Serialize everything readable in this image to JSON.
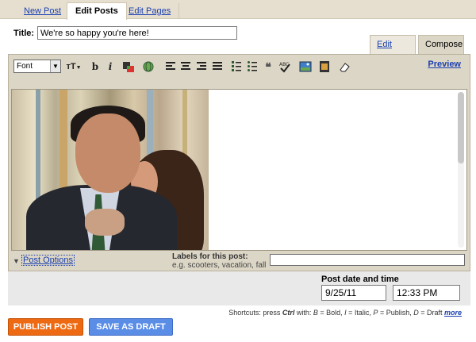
{
  "tabs": {
    "new_post": "New Post",
    "edit_posts": "Edit Posts",
    "edit_pages": "Edit Pages"
  },
  "title": {
    "label": "Title:",
    "value": "We're so happy you're here!"
  },
  "modes": {
    "edit_html": "Edit Html",
    "compose": "Compose"
  },
  "toolbar": {
    "font_select": "Font",
    "text_size": "тT",
    "bold": "b",
    "italic": "i",
    "preview": "Preview"
  },
  "post_options": {
    "link": "Post Options",
    "labels_title": "Labels for this post:",
    "labels_hint": "e.g. scooters, vacation, fall",
    "labels_value": ""
  },
  "post_date": {
    "label": "Post date and time",
    "date": "9/25/11",
    "time": "12:33 PM"
  },
  "shortcuts": {
    "prefix": "Shortcuts: press ",
    "ctrl": "Ctrl",
    "with": " with: ",
    "b": "B",
    "bold": " = Bold, ",
    "i": "I",
    "italic": " = Italic, ",
    "p": "P",
    "publish": " = Publish, ",
    "d": "D",
    "draft": " = Draft ",
    "more": "more"
  },
  "buttons": {
    "publish": "PUBLISH POST",
    "save_draft": "SAVE AS DRAFT"
  },
  "colors": {
    "publish": "#ee6a12",
    "save_draft": "#5a8de6",
    "link": "#1a3fb0",
    "chrome": "#dcd6c6"
  }
}
